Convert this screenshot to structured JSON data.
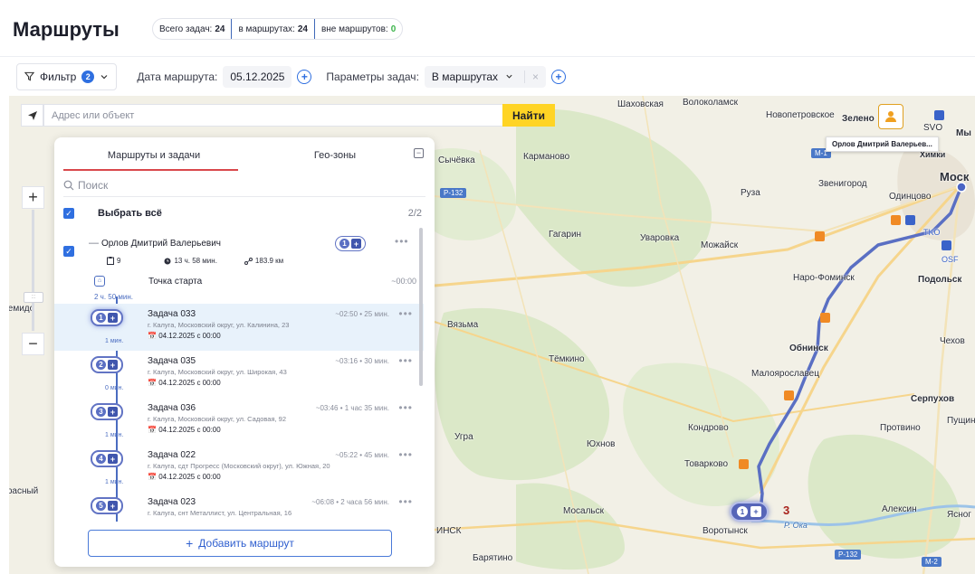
{
  "header": {
    "title": "Маршруты",
    "counters": {
      "total_label": "Всего задач:",
      "total_value": "24",
      "in_routes_label": "в маршрутах:",
      "in_routes_value": "24",
      "out_routes_label": "вне маршрутов:",
      "out_routes_value": "0"
    }
  },
  "toolbar": {
    "filter_label": "Фильтр",
    "filter_count": "2",
    "date_label": "Дата маршрута:",
    "date_value": "05.12.2025",
    "params_label": "Параметры задач:",
    "params_value": "В маршрутах"
  },
  "map": {
    "search_placeholder": "Адрес или объект",
    "find_label": "Найти",
    "driver_tooltip": "Орлов Дмитрий Валерьев...",
    "route_marker_index": "1",
    "cluster_count": "3",
    "places": [
      "Шаховская",
      "Волоколамск",
      "Новопетровское",
      "Зелено",
      "SVO",
      "Мы",
      "Химки",
      "Моск",
      "Сычёвка",
      "Карманово",
      "Руза",
      "Звенигород",
      "Одинцово",
      "Гагарин",
      "Уваровка",
      "Можайск",
      "Наро-Фоминск",
      "Подольск",
      "Демидо",
      "Вязьма",
      "Обнинск",
      "Чехов",
      "Тёмкино",
      "Малоярославец",
      "Серпухов",
      "Пущин",
      "Протвино",
      "Кондрово",
      "Угра",
      "Юхнов",
      "Товарково",
      "Красный",
      "Мосальск",
      "Алексин",
      "Ясног",
      "Воротынск",
      "Р. Ока",
      "ИНСК",
      "Барятино",
      "OSF",
      "TKO"
    ],
    "road_badges": [
      "М-1",
      "Р-132",
      "Р-132",
      "М-2"
    ]
  },
  "panel": {
    "tab_routes": "Маршруты и задачи",
    "tab_geozones": "Гео-зоны",
    "search_placeholder": "Поиск",
    "select_all_label": "Выбрать всё",
    "select_all_count": "2/2",
    "driver": {
      "name": "Орлов Дмитрий Валерьевич",
      "pill_index": "1",
      "task_count": "9",
      "duration": "13 ч. 58 мин.",
      "distance": "183.9 км",
      "start_label": "Точка старта",
      "start_time": "~00:00",
      "start_gap": "2 ч. 50 мин."
    },
    "tasks": [
      {
        "index": "1",
        "title": "Задача 033",
        "meta": "~02:50 • 25 мин.",
        "address": "г. Калуга, Московский округ, ул. Калинина, 23",
        "date": "04.12.2025 с 00:00",
        "gap": "1 мин."
      },
      {
        "index": "2",
        "title": "Задача 035",
        "meta": "~03:16 • 30 мин.",
        "address": "г. Калуга, Московский округ, ул. Широкая, 43",
        "date": "04.12.2025 с 00:00",
        "gap": "0 мин."
      },
      {
        "index": "3",
        "title": "Задача 036",
        "meta": "~03:46 • 1 час 35 мин.",
        "address": "г. Калуга, Московский округ, ул. Садовая, 92",
        "date": "04.12.2025 с 00:00",
        "gap": "1 мин."
      },
      {
        "index": "4",
        "title": "Задача 022",
        "meta": "~05:22 • 45 мин.",
        "address": "г. Калуга, сдт Прогресс (Московский округ), ул. Южная, 20",
        "date": "04.12.2025 с 00:00",
        "gap": "1 мин."
      },
      {
        "index": "5",
        "title": "Задача 023",
        "meta": "~06:08 • 2 часа 56 мин.",
        "address": "г. Калуга, снт Металлист, ул. Центральная, 16",
        "date": "",
        "gap": ""
      }
    ],
    "add_route_label": "Добавить маршрут"
  },
  "colors": {
    "accent": "#2f6fe0",
    "route_line": "#5a6fc3",
    "find_button": "#ffd424",
    "tab_underline": "#d9484c"
  }
}
